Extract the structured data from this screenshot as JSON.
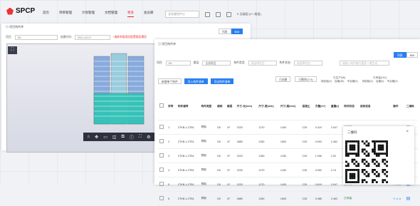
{
  "header": {
    "logo": "SPCP",
    "nav": [
      "首页",
      "项目管理",
      "计划管理",
      "文档管理",
      "更多",
      "会员库"
    ],
    "active_nav": "更多",
    "search_placeholder": "全局查找中心",
    "user": "E 无敌组 (0一般组)"
  },
  "back_panel": {
    "breadcrumb": "◎ 项目构件库",
    "filter_label_date": "创建时间:",
    "date_value": "2021-04-27",
    "link": "*请联系管理员配置楼层模型",
    "toggle_a": "列表",
    "toggle_b": "BIM"
  },
  "viewer": {
    "toolbar_icons": [
      "home-icon",
      "move-icon",
      "ruler-icon",
      "section-icon",
      "layers-icon",
      "info-icon",
      "fullscreen-icon",
      "gear-icon"
    ]
  },
  "front_panel": {
    "breadcrumb": "◎ 项目构件库",
    "toggle_active": "列表",
    "toggle_other": "BIM",
    "filters": {
      "project_label": "项目:",
      "project_value": "D5",
      "floor_label": "楼层:",
      "floor_value": "全部楼层",
      "type_label": "构件类型:",
      "type_placeholder": "请选择类型",
      "status_label": "构件状态:",
      "status_placeholder": "请选择状态",
      "search_placeholder": "请输入构件编号搜索一键生成"
    },
    "buttons": {
      "new": "新增单个构件",
      "import": "导入构件清单",
      "qr": "导出构件清单"
    },
    "stats": {
      "total": "已创建",
      "total2": "已删除(174)",
      "sec1_title": "已生产(36)",
      "sec1_sub": [
        "待检验(0)",
        "合格(36)",
        "不合格(0)"
      ],
      "sec2_title": "已吊装(101)",
      "sec2_sub": [
        "待检验(0)",
        "合格(0)",
        "不合格(0)"
      ]
    },
    "columns": [
      "序号",
      "构件编号",
      "构件类型",
      "楼栋",
      "楼层",
      "尺寸-长(mm)",
      "尺寸-宽(mm)",
      "尺寸-高(mm)",
      "混凝土",
      "方量(m³)",
      "重量(t)",
      "构件状态",
      "验收状态",
      "生产状态",
      "该商信息",
      "操作",
      "二维码"
    ],
    "rows": [
      {
        "no": "1",
        "code": "ZTKB-1-ZTB1",
        "type": "预制",
        "building": "D5",
        "floor": "1F",
        "len": "3220",
        "wid": "1270",
        "hei": "1430",
        "grade": "C35",
        "vol": "0.419",
        "wt": "2.047",
        "status": "已吊装",
        "accept": "",
        "prod": "已入库",
        "time": "2021-04-27 15:04:06"
      },
      {
        "no": "2",
        "code": "ZTKB-1-ZTB1",
        "type": "预制",
        "building": "D5",
        "floor": "1F",
        "len": "3880",
        "wid": "1280",
        "hei": "1600",
        "grade": "C35",
        "vol": "0.693",
        "wt": "2.462",
        "status": "已吊装",
        "accept": "",
        "prod": "",
        "time": ""
      },
      {
        "no": "3",
        "code": "ZTKB-1-ZTB1",
        "type": "预制",
        "building": "D5",
        "floor": "1F",
        "len": "3220",
        "wid": "1280",
        "hei": "1430",
        "grade": "C35",
        "vol": "1.006",
        "wt": "2.52",
        "status": "已吊装",
        "accept": "",
        "prod": "",
        "time": ""
      },
      {
        "no": "4",
        "code": "ZTKB-1-ZTB1",
        "type": "预制",
        "building": "D5",
        "floor": "1F",
        "len": "3230",
        "wid": "1270",
        "hei": "1430",
        "grade": "C35",
        "vol": "0.952",
        "wt": "2.13",
        "status": "已吊装",
        "accept": "",
        "prod": "",
        "time": ""
      },
      {
        "no": "5",
        "code": "ZTKB-1-ZTB1",
        "type": "预制",
        "building": "D5",
        "floor": "1F",
        "len": "3220",
        "wid": "1270",
        "hei": "1430",
        "grade": "C35",
        "vol": "0.819",
        "wt": "2.047",
        "status": "已吊装",
        "accept": "",
        "prod": "",
        "time": ""
      },
      {
        "no": "6",
        "code": "ZTKB-1-ZTB1",
        "type": "预制",
        "building": "D5",
        "floor": "1F",
        "len": "3880",
        "wid": "1280",
        "hei": "1600",
        "grade": "C35",
        "vol": "0.985",
        "wt": "2.462",
        "status": "已吊装",
        "accept": "",
        "prod": "",
        "time": ""
      }
    ],
    "dialog_title": "二维码"
  }
}
